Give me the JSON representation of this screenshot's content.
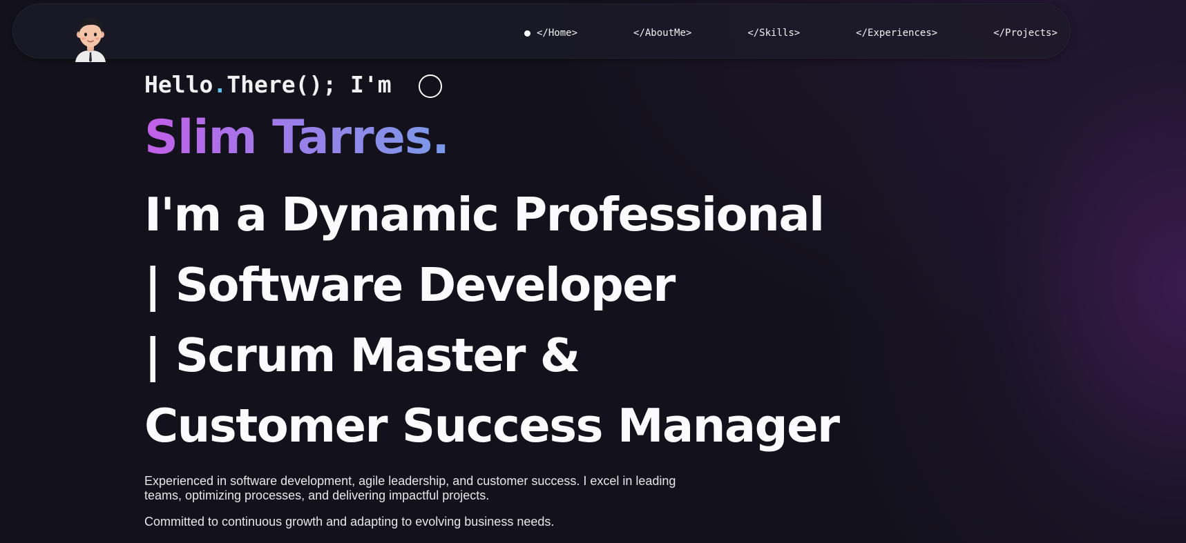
{
  "nav": {
    "items": [
      {
        "label": "</Home>",
        "active": true
      },
      {
        "label": "</AboutMe>"
      },
      {
        "label": "</Skills>"
      },
      {
        "label": "</Experiences>"
      },
      {
        "label": "</Projects>"
      }
    ],
    "active_indicator": "dot-icon"
  },
  "hero": {
    "greeting_part1": "Hello",
    "greeting_dot": ".",
    "greeting_part2": "There(); I'm",
    "name": "Slim Tarres.",
    "headline_lines": [
      "I'm a Dynamic Professional",
      "| Software Developer",
      "| Scrum Master &",
      "Customer Success Manager"
    ],
    "description": "Experienced in software development, agile leadership, and customer success. I excel in leading teams, optimizing processes, and delivering impactful projects.",
    "description2": "Committed to continuous growth and adapting to evolving business needs."
  },
  "colors": {
    "background": "#13121c",
    "name_gradient_start": "#c25fe8",
    "name_gradient_end": "#7a9ae8",
    "greeting_dot": "#5ec3f0"
  }
}
